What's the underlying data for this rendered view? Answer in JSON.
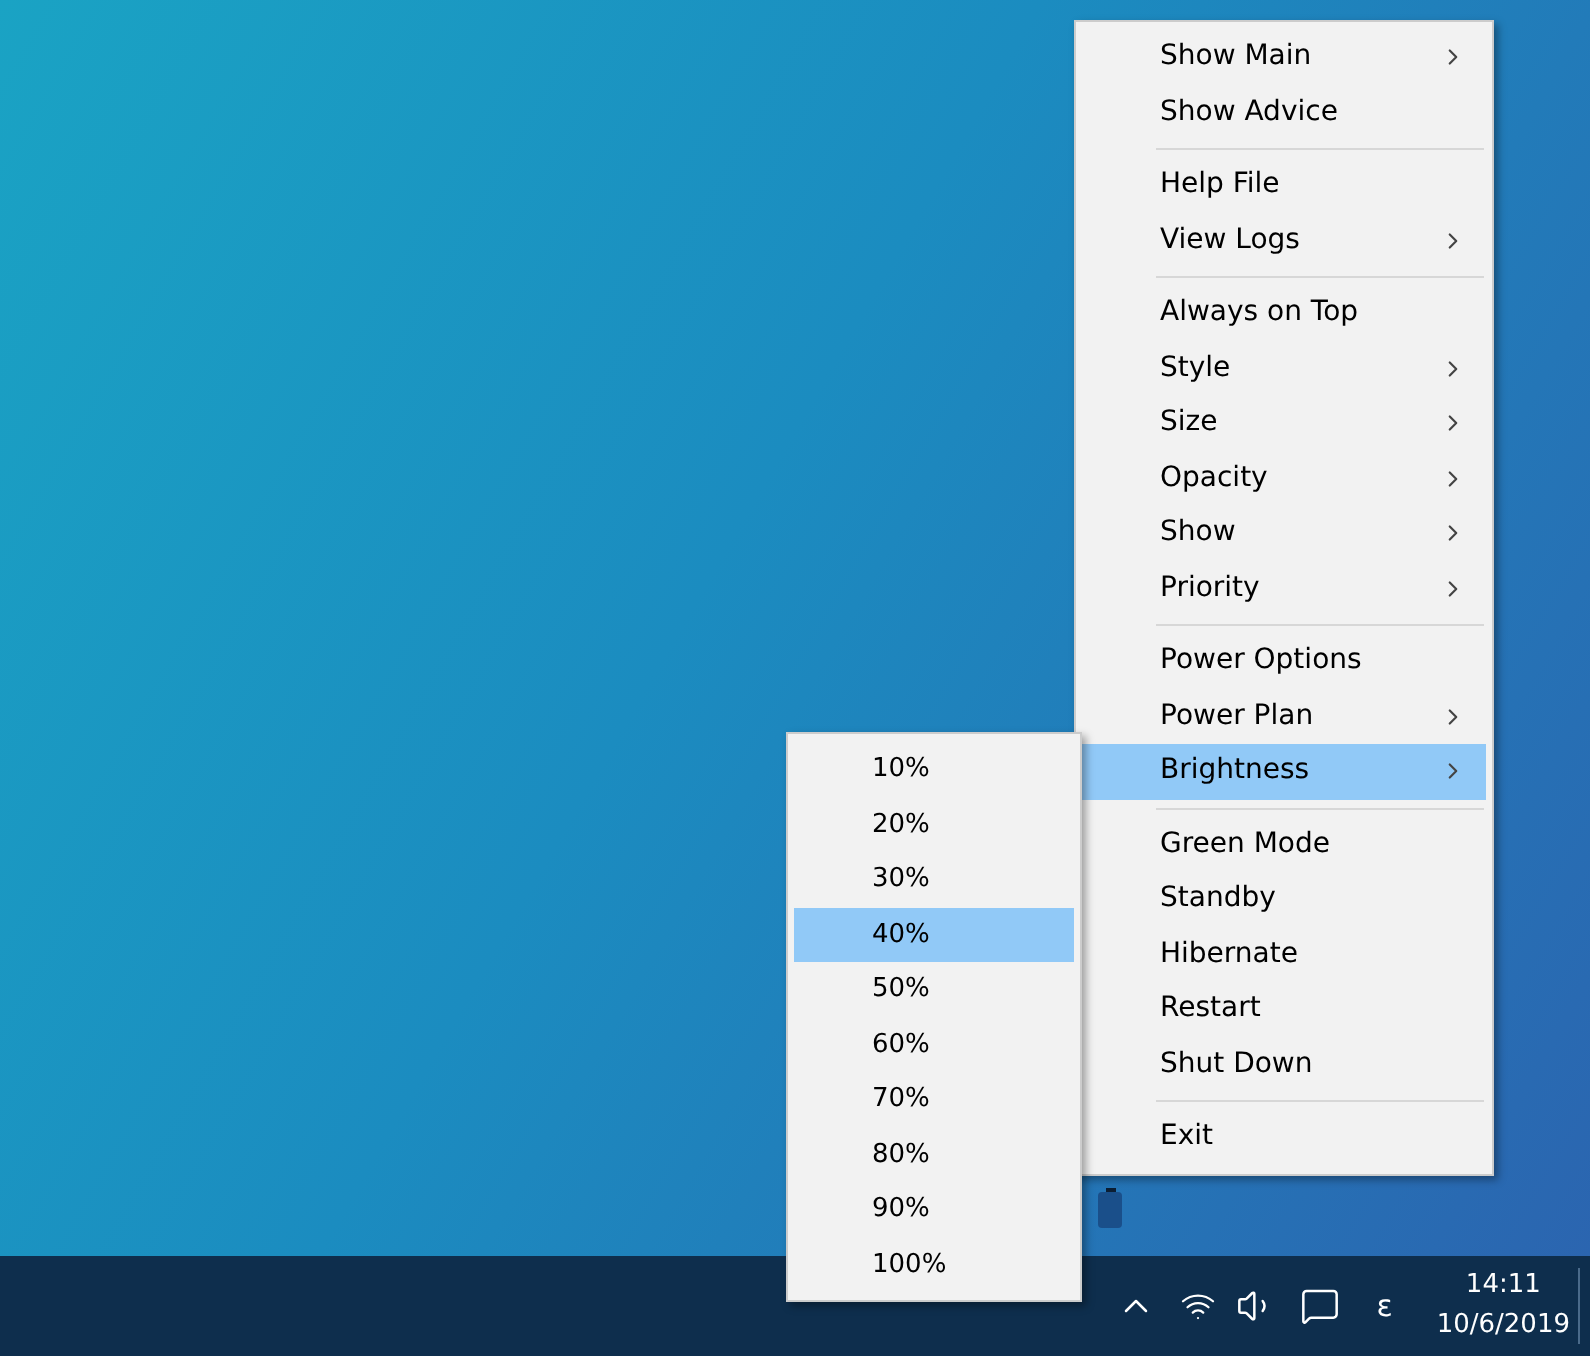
{
  "context_menu": {
    "items": [
      {
        "kind": "item",
        "label": "Show Main",
        "has_submenu": true,
        "selected": false
      },
      {
        "kind": "item",
        "label": "Show Advice",
        "has_submenu": false,
        "selected": false
      },
      {
        "kind": "separator"
      },
      {
        "kind": "item",
        "label": "Help File",
        "has_submenu": false,
        "selected": false
      },
      {
        "kind": "item",
        "label": "View Logs",
        "has_submenu": true,
        "selected": false
      },
      {
        "kind": "separator"
      },
      {
        "kind": "item",
        "label": "Always on Top",
        "has_submenu": false,
        "selected": false
      },
      {
        "kind": "item",
        "label": "Style",
        "has_submenu": true,
        "selected": false
      },
      {
        "kind": "item",
        "label": "Size",
        "has_submenu": true,
        "selected": false
      },
      {
        "kind": "item",
        "label": "Opacity",
        "has_submenu": true,
        "selected": false
      },
      {
        "kind": "item",
        "label": "Show",
        "has_submenu": true,
        "selected": false
      },
      {
        "kind": "item",
        "label": "Priority",
        "has_submenu": true,
        "selected": false
      },
      {
        "kind": "separator"
      },
      {
        "kind": "item",
        "label": "Power Options",
        "has_submenu": false,
        "selected": false
      },
      {
        "kind": "item",
        "label": "Power Plan",
        "has_submenu": true,
        "selected": false
      },
      {
        "kind": "item",
        "label": "Brightness",
        "has_submenu": true,
        "selected": true
      },
      {
        "kind": "separator"
      },
      {
        "kind": "item",
        "label": "Green Mode",
        "has_submenu": false,
        "selected": false
      },
      {
        "kind": "item",
        "label": "Standby",
        "has_submenu": false,
        "selected": false
      },
      {
        "kind": "item",
        "label": "Hibernate",
        "has_submenu": false,
        "selected": false
      },
      {
        "kind": "item",
        "label": "Restart",
        "has_submenu": false,
        "selected": false
      },
      {
        "kind": "item",
        "label": "Shut Down",
        "has_submenu": false,
        "selected": false
      },
      {
        "kind": "separator"
      },
      {
        "kind": "item",
        "label": "Exit",
        "has_submenu": false,
        "selected": false
      }
    ]
  },
  "brightness_submenu": {
    "items": [
      {
        "label": "10%",
        "selected": false
      },
      {
        "label": "20%",
        "selected": false
      },
      {
        "label": "30%",
        "selected": false
      },
      {
        "label": "40%",
        "selected": true
      },
      {
        "label": "50%",
        "selected": false
      },
      {
        "label": "60%",
        "selected": false
      },
      {
        "label": "70%",
        "selected": false
      },
      {
        "label": "80%",
        "selected": false
      },
      {
        "label": "90%",
        "selected": false
      },
      {
        "label": "100%",
        "selected": false
      }
    ]
  },
  "taskbar": {
    "input_indicator": "ε",
    "time": "14:11",
    "date": "10/6/2019"
  }
}
